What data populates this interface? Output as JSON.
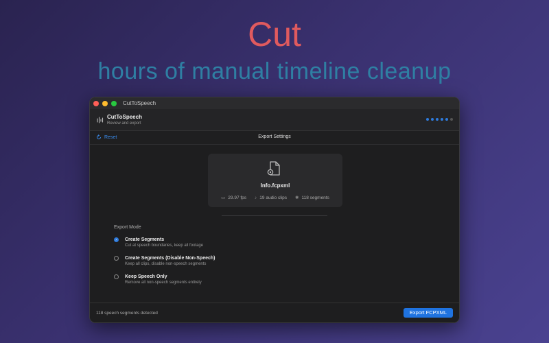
{
  "promo": {
    "headline": "Cut",
    "subheadline": "hours of manual timeline cleanup",
    "headline_color": "#e05a5e",
    "subheadline_color": "#2f7fa3"
  },
  "window": {
    "title": "CutToSpeech"
  },
  "app_header": {
    "name": "CutToSpeech",
    "subtitle": "Review and export",
    "icon": "waveform-icon",
    "step_dots": {
      "total": 6,
      "active": 5
    }
  },
  "toolbar": {
    "reset_label": "Reset",
    "title": "Export Settings",
    "accent": "#3a8df0"
  },
  "file": {
    "name": "Info.fcpxml",
    "icon": "document-gear-icon",
    "fps": "29.97 fps",
    "audio_clips": "19 audio clips",
    "segments": "118 segments"
  },
  "export_mode": {
    "label": "Export Mode",
    "selected": 0,
    "options": [
      {
        "label": "Create Segments",
        "description": "Cut at speech boundaries, keep all footage"
      },
      {
        "label": "Create Segments (Disable Non-Speech)",
        "description": "Keep all clips, disable non-speech segments"
      },
      {
        "label": "Keep Speech Only",
        "description": "Remove all non-speech segments entirely"
      }
    ]
  },
  "footer": {
    "status": "118 speech segments detected",
    "export_label": "Export FCPXML",
    "button_color": "#1f73e0"
  }
}
